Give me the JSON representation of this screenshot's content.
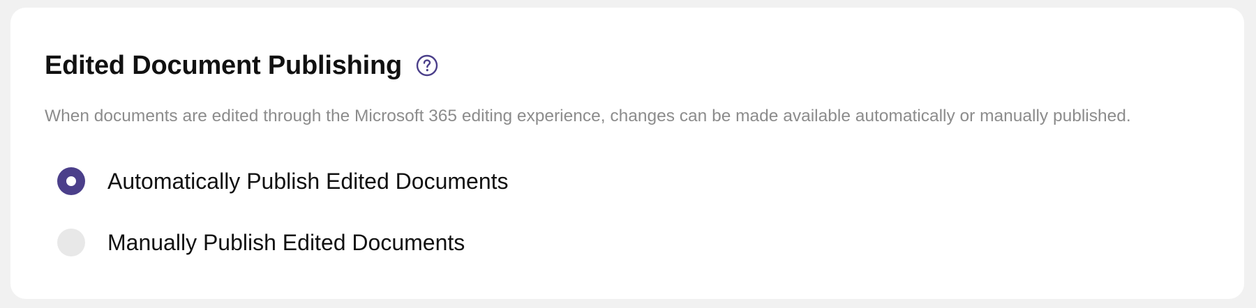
{
  "section": {
    "title": "Edited Document Publishing",
    "help_icon": "question-circle-icon",
    "description": "When documents are edited through the Microsoft 365 editing experience, changes can be made available automatically or manually published."
  },
  "options": [
    {
      "label": "Automatically Publish Edited Documents",
      "selected": true
    },
    {
      "label": "Manually Publish Edited Documents",
      "selected": false
    }
  ],
  "colors": {
    "accent": "#4b3f8a",
    "unselected": "#e8e8e8",
    "description_text": "#8c8c8c",
    "background": "#f1f1f1"
  }
}
